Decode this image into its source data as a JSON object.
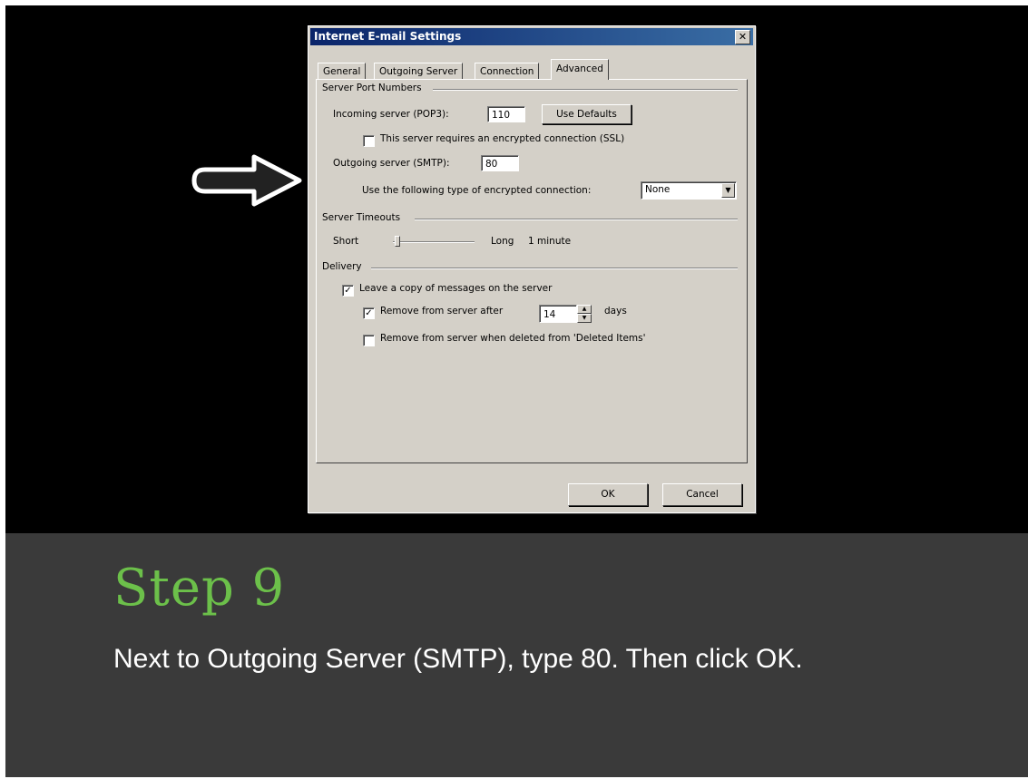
{
  "dialog": {
    "title": "Internet E-mail Settings",
    "close_glyph": "✕",
    "tabs": [
      {
        "label": "General"
      },
      {
        "label": "Outgoing Server"
      },
      {
        "label": "Connection"
      },
      {
        "label": "Advanced"
      }
    ],
    "active_tab": "Advanced",
    "server_ports": {
      "heading": "Server Port Numbers",
      "incoming_label": "Incoming server (POP3):",
      "incoming_value": "110",
      "use_defaults": "Use Defaults",
      "ssl_label": "This server requires an encrypted connection (SSL)",
      "ssl_checked": false,
      "outgoing_label": "Outgoing server (SMTP):",
      "outgoing_value": "80",
      "encryption_label": "Use the following type of encrypted connection:",
      "encryption_value": "None"
    },
    "timeouts": {
      "heading": "Server Timeouts",
      "short_label": "Short",
      "long_label": "Long",
      "value_label": "1 minute"
    },
    "delivery": {
      "heading": "Delivery",
      "leave_copy_label": "Leave a copy of messages on the server",
      "leave_copy_checked": true,
      "remove_after_label": "Remove from server after",
      "remove_after_checked": true,
      "remove_after_days": "14",
      "days_label": "days",
      "remove_deleted_label": "Remove from server when deleted from 'Deleted Items'",
      "remove_deleted_checked": false
    },
    "ok_label": "OK",
    "cancel_label": "Cancel"
  },
  "caption": {
    "title": "Step 9",
    "text": "Next to Outgoing Server (SMTP), type 80. Then click OK."
  },
  "colors": {
    "step_title": "#6cc04a",
    "slide_bg": "#000000",
    "caption_bg": "#3a3a3a",
    "dialog_face": "#d4d0c8",
    "titlebar": "#0a246a"
  }
}
